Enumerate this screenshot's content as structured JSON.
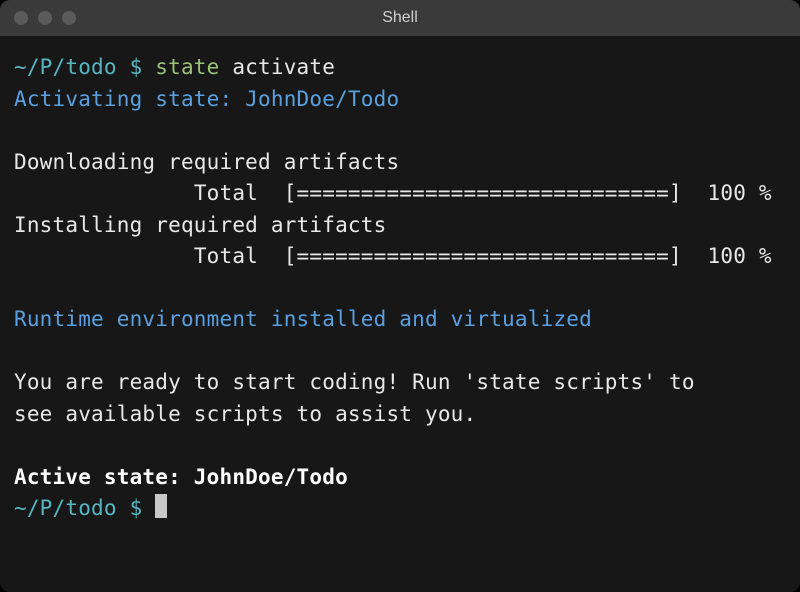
{
  "titlebar": {
    "title": "Shell"
  },
  "terminal": {
    "prompt_path": "~/P/todo",
    "prompt_symbol": "$",
    "command_name": "state",
    "command_arg": "activate",
    "activating_line": "Activating state: JohnDoe/Todo",
    "downloading_label": "Downloading required artifacts",
    "total_label": "Total",
    "progress_bar": "[=============================]",
    "progress_pct": "100 %",
    "installing_label": "Installing required artifacts",
    "runtime_line": "Runtime environment installed and virtualized",
    "ready_line1": "You are ready to start coding! Run 'state scripts' to",
    "ready_line2": "see available scripts to assist you.",
    "active_state_line": "Active state: JohnDoe/Todo"
  }
}
